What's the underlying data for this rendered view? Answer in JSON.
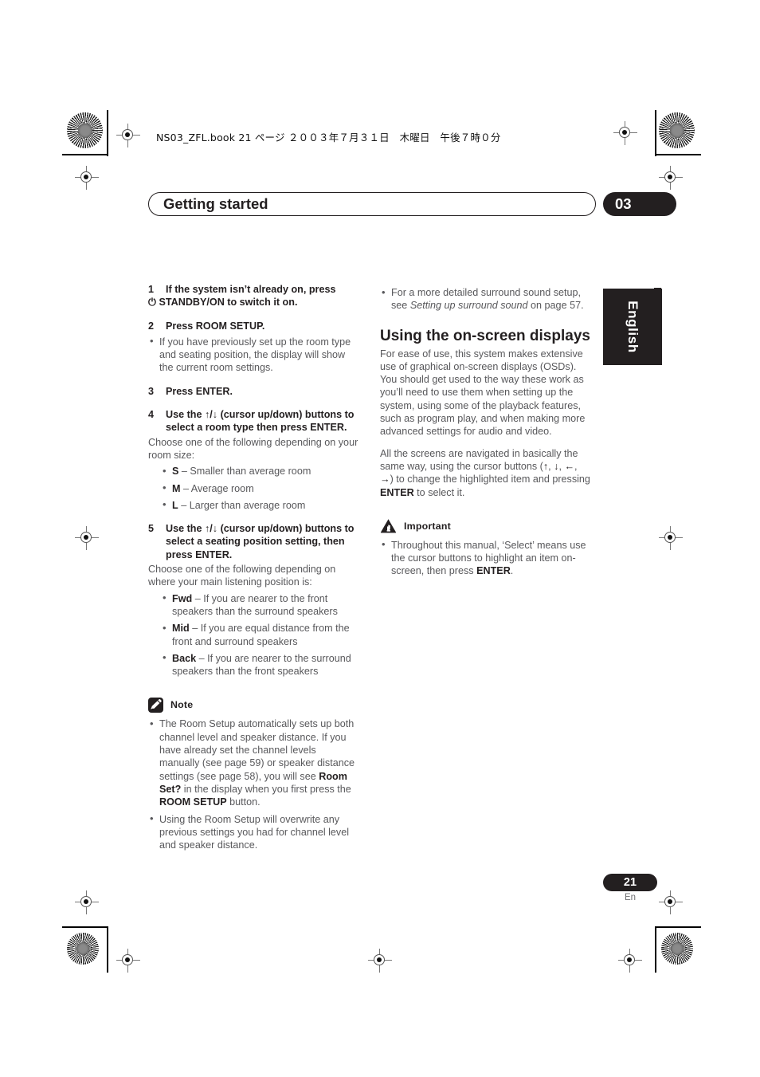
{
  "header": {
    "running_head": "NS03_ZFL.book  21 ページ  ２００３年７月３１日　木曜日　午後７時０分",
    "chapter_title": "Getting started",
    "chapter_number": "03",
    "language_tab": "English"
  },
  "footer": {
    "page_number": "21",
    "page_language": "En"
  },
  "colors": {
    "ink": "#231f20",
    "body_text": "#58585b",
    "badge_background": "#231f20",
    "badge_text": "#ffffff"
  },
  "left_column": {
    "step1": {
      "num": "1",
      "text_before_symbol": "If the system isn’t already on, press",
      "power_symbol": "⏻",
      "text_after_symbol": "STANDBY/ON to switch it on."
    },
    "step2": {
      "num": "2",
      "text": "Press ROOM SETUP.",
      "bullets": [
        "If you have previously set up the room type and seating position, the display will show the current room settings."
      ]
    },
    "step3": {
      "num": "3",
      "text": "Press ENTER."
    },
    "step4": {
      "num": "4",
      "text_a": "Use the",
      "arrow_up": "↑",
      "slash": "/",
      "arrow_down": "↓",
      "text_b": "(cursor up/down) buttons to select a room type then press ENTER.",
      "intro": "Choose one of the following depending on your room size:",
      "options": [
        {
          "key": "S",
          "desc": "– Smaller than average room"
        },
        {
          "key": "M",
          "desc": "– Average room"
        },
        {
          "key": "L",
          "desc": "– Larger than average room"
        }
      ]
    },
    "step5": {
      "num": "5",
      "text_a": "Use the",
      "arrow_up": "↑",
      "slash": "/",
      "arrow_down": "↓",
      "text_b": "(cursor up/down) buttons to select a seating position setting, then press ENTER.",
      "intro": "Choose one of the following depending on where your main listening position is:",
      "options": [
        {
          "key": "Fwd",
          "desc": "– If you are nearer to the front speakers than the surround speakers"
        },
        {
          "key": "Mid",
          "desc": "– If you are equal distance from the front and surround speakers"
        },
        {
          "key": "Back",
          "desc": "– If you are nearer to the surround speakers than the front speakers"
        }
      ]
    },
    "note": {
      "caption": "Note",
      "icon": "pencil-icon",
      "bullets": [
        {
          "part1": "The Room Setup automatically sets up both channel level and speaker distance. If you have already set the channel levels manually (see page 59) or speaker distance settings (see page 58), you will see ",
          "bold1": "Room Set?",
          "part2": " in the display when you first press the ",
          "bold2": "ROOM SETUP",
          "part3": " button."
        },
        {
          "part1": "Using the Room Setup will overwrite any previous settings you had for channel level and speaker distance.",
          "bold1": "",
          "part2": "",
          "bold2": "",
          "part3": ""
        }
      ]
    }
  },
  "right_column": {
    "top_bullet": {
      "part1": "For a more detailed surround sound setup, see ",
      "italic": "Setting up surround sound",
      "part2": " on page 57."
    },
    "section_heading": "Using the on-screen displays",
    "paragraph1": "For ease of use, this system makes extensive use of graphical on-screen displays (OSDs). You should get used to the way these work as you’ll need to use them when setting up the system, using some of the playback features, such as program play, and when making more advanced settings for audio and video.",
    "paragraph2": {
      "part1": "All the screens are navigated in basically the same way, using the cursor buttons (",
      "arrow_up": "↑",
      "sep1": ", ",
      "arrow_down": "↓",
      "sep2": ", ",
      "arrow_left": "←",
      "sep3": ", ",
      "arrow_right": "→",
      "part2": ") to change the highlighted item and pressing ",
      "bold": "ENTER",
      "part3": " to select it."
    },
    "important": {
      "caption": "Important",
      "icon": "warning-hand-icon",
      "bullet": {
        "part1": "Throughout this manual, ‘Select’ means use the cursor buttons to highlight an item on-screen, then press ",
        "bold": "ENTER",
        "part2": "."
      }
    }
  }
}
